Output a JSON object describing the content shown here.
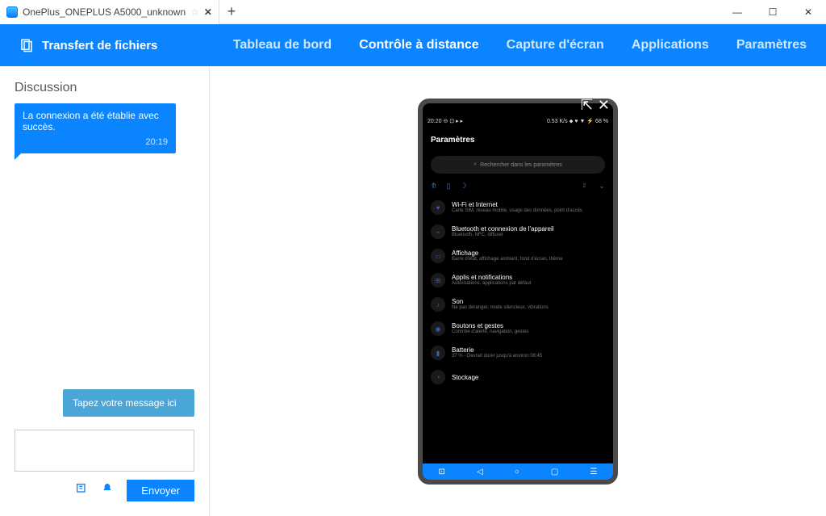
{
  "window": {
    "tab_title": "OnePlus_ONEPLUS A5000_unknown"
  },
  "header": {
    "file_transfer": "Transfert de fichiers",
    "nav": {
      "dashboard": "Tableau de bord",
      "remote": "Contrôle à distance",
      "screenshot": "Capture d'écran",
      "apps": "Applications",
      "settings": "Paramètres"
    }
  },
  "chat": {
    "title": "Discussion",
    "system_msg": "La connexion a été établie avec succès.",
    "system_time": "20:19",
    "hint": "Tapez votre message ici",
    "send": "Envoyer"
  },
  "phone": {
    "status_left": "20:20  ⊖ ⊡ ▸ ▸",
    "status_right": "0.53 K/s ⬥ ♥ ▼ ⚡ 68 %",
    "title": "Paramètres",
    "search_placeholder": "Rechercher dans les paramètres",
    "quick_badge": "2",
    "items": [
      {
        "icon": "♥",
        "title": "Wi-Fi et Internet",
        "sub": "Carte SIM, réseau mobile, usage des données, point d'accès"
      },
      {
        "icon": "⌁",
        "title": "Bluetooth et connexion de l'appareil",
        "sub": "Bluetooth, NFC, diffuser"
      },
      {
        "icon": "▭",
        "title": "Affichage",
        "sub": "Barre d'état, affichage ambiant, fond d'écran, thème"
      },
      {
        "icon": "⊞",
        "title": "Applis et notifications",
        "sub": "Autorisations, applications par défaut"
      },
      {
        "icon": "♪",
        "title": "Son",
        "sub": "Ne pas déranger, mode silencieux, vibrations"
      },
      {
        "icon": "◉",
        "title": "Boutons et gestes",
        "sub": "Contrôle d'alerte, navigation, gestes"
      },
      {
        "icon": "▮",
        "title": "Batterie",
        "sub": "37 % - Devrait durer jusqu'à environ 08:45"
      },
      {
        "icon": "◔",
        "title": "Stockage",
        "sub": ""
      }
    ]
  }
}
